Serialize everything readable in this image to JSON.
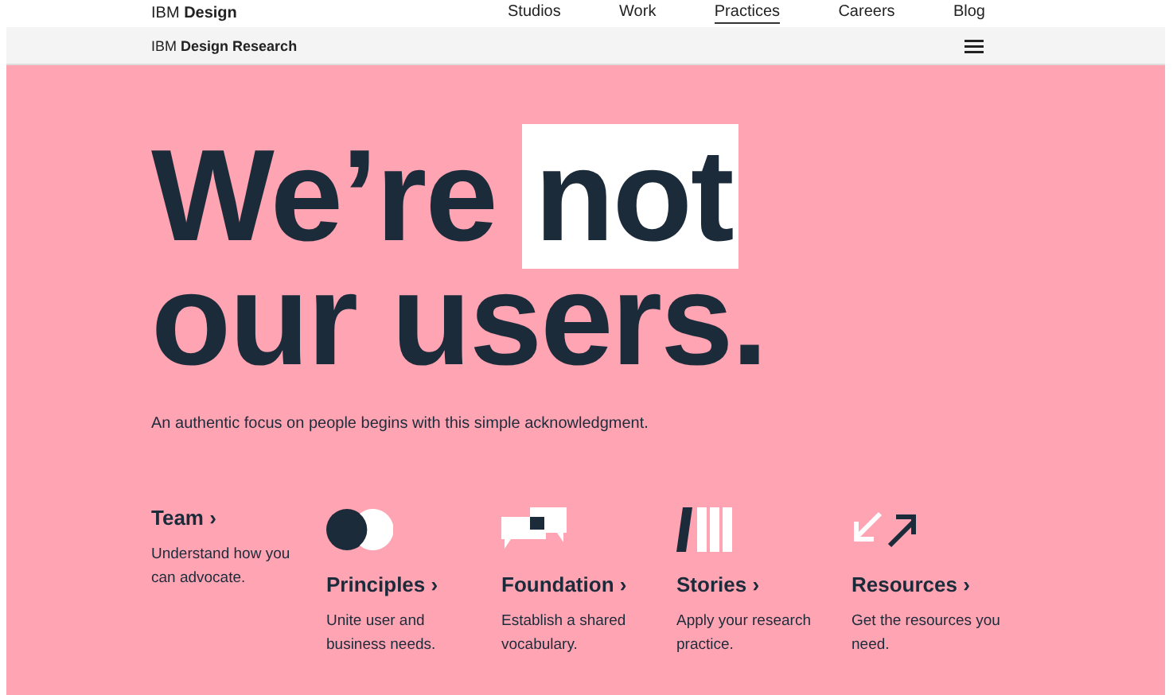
{
  "top_nav": {
    "brand_prefix": "IBM",
    "brand_name": "Design",
    "items": [
      {
        "label": "Studios",
        "selected": false
      },
      {
        "label": "Work",
        "selected": false
      },
      {
        "label": "Practices",
        "selected": true
      },
      {
        "label": "Careers",
        "selected": false
      },
      {
        "label": "Blog",
        "selected": false
      }
    ]
  },
  "sub_nav": {
    "brand_prefix": "IBM",
    "brand_name": "Design Research"
  },
  "hero": {
    "headline_start": "We’re",
    "headline_highlight": "not",
    "headline_end": "our users.",
    "intro": "An authentic focus on people begins with this simple acknowledgment."
  },
  "cards": [
    {
      "title": "Team",
      "arrow": "›",
      "description": "Understand how you can advocate."
    },
    {
      "title": "Principles",
      "arrow": "›",
      "description": "Unite user and business needs."
    },
    {
      "title": "Foundation",
      "arrow": "›",
      "description": "Establish a shared vocabulary."
    },
    {
      "title": "Stories",
      "arrow": "›",
      "description": "Apply your research practice."
    },
    {
      "title": "Resources",
      "arrow": "›",
      "description": "Get the resources you need."
    }
  ]
}
